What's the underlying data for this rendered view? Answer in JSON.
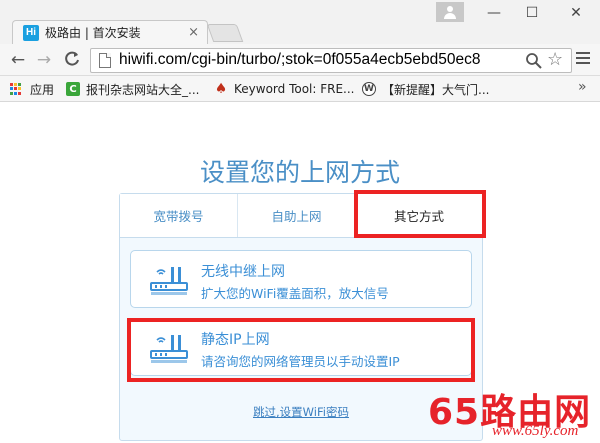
{
  "browser": {
    "tab": {
      "favicon_text": "Hi",
      "title": "极路由 | 首次安装",
      "close": "×"
    },
    "window_controls": {
      "minimize": "—",
      "maximize": "☐",
      "close": "✕"
    },
    "nav": {
      "back": "←",
      "forward": "→",
      "reload": "C"
    },
    "address_bar": {
      "url": "hiwifi.com/cgi-bin/turbo/;stok=0f055a4ecb5ebd50ec8"
    },
    "star": "☆",
    "bookmarks": [
      {
        "label": "应用",
        "icon": "apps-grid-icon"
      },
      {
        "label": "报刊杂志网站大全_...",
        "icon": "c-favicon-icon"
      },
      {
        "label": "Keyword Tool: FRE...",
        "icon": "fire-favicon-icon"
      },
      {
        "label": "【新提醒】大气门...",
        "icon": "wordpress-icon"
      }
    ],
    "bookmarks_more": "»"
  },
  "page": {
    "heading": "设置您的上网方式",
    "tabs": [
      {
        "label": "宽带拨号"
      },
      {
        "label": "自助上网"
      },
      {
        "label": "其它方式"
      }
    ],
    "options": [
      {
        "title": "无线中继上网",
        "description": "扩大您的WiFi覆盖面积，放大信号"
      },
      {
        "title": "静态IP上网",
        "description": "请咨询您的网络管理员以手动设置IP"
      }
    ],
    "skip_link": "跳过,设置WiFi密码"
  },
  "watermark": {
    "main": "65路由网",
    "url": "www.65ly.com"
  },
  "colors": {
    "accent": "#4a8fc6",
    "link": "#3b8fd6",
    "highlight": "#ec2323",
    "watermark": "#e6232a"
  }
}
